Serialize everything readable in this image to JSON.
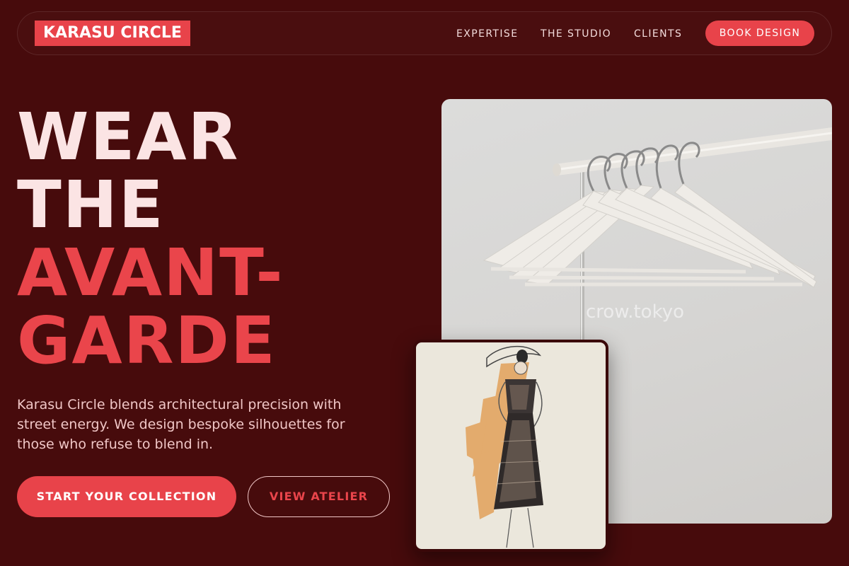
{
  "nav": {
    "logo": "KARASU CIRCLE",
    "links": [
      "EXPERTISE",
      "THE STUDIO",
      "CLIENTS"
    ],
    "cta": "BOOK DESIGN"
  },
  "hero": {
    "title_lines": [
      "WEAR",
      "THE",
      "AVANT-",
      "GARDE"
    ],
    "description": "Karasu Circle blends architectural precision with street energy. We design bespoke silhouettes for those who refuse to blend in.",
    "primary_cta": "START YOUR COLLECTION",
    "secondary_cta": "VIEW ATELIER"
  },
  "images": {
    "main_photo": "clothing-rack-with-white-hangers",
    "main_watermark": "crow.tokyo",
    "sketch_photo": "fashion-sketch-lace-dress"
  },
  "colors": {
    "background": "#470b0c",
    "accent": "#e8434a",
    "title_light": "#fbe4e4",
    "body_text": "#f0c6c6"
  }
}
